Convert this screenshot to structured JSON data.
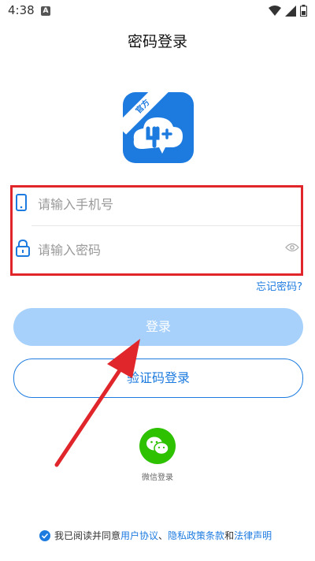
{
  "status_bar": {
    "time": "4:38",
    "notification": "A"
  },
  "header": {
    "title": "密码登录"
  },
  "logo": {
    "ribbon_text": "官方",
    "bg_color": "#1d7be0"
  },
  "form": {
    "phone_placeholder": "请输入手机号",
    "password_placeholder": "请输入密码",
    "forgot_password": "忘记密码?"
  },
  "buttons": {
    "login": "登录",
    "sms_login": "验证码登录"
  },
  "third_party": {
    "wechat_label": "微信登录"
  },
  "agreement": {
    "prefix": "我已阅读并同意",
    "user_agreement": "用户协议",
    "sep": "、",
    "privacy_policy": "隐私政策条款",
    "and": "和",
    "legal_notice": "法律声明"
  },
  "colors": {
    "accent": "#1d7be0",
    "annotation": "#e0262b",
    "login_disabled": "#a7d1fb",
    "wechat": "#2dc100"
  }
}
